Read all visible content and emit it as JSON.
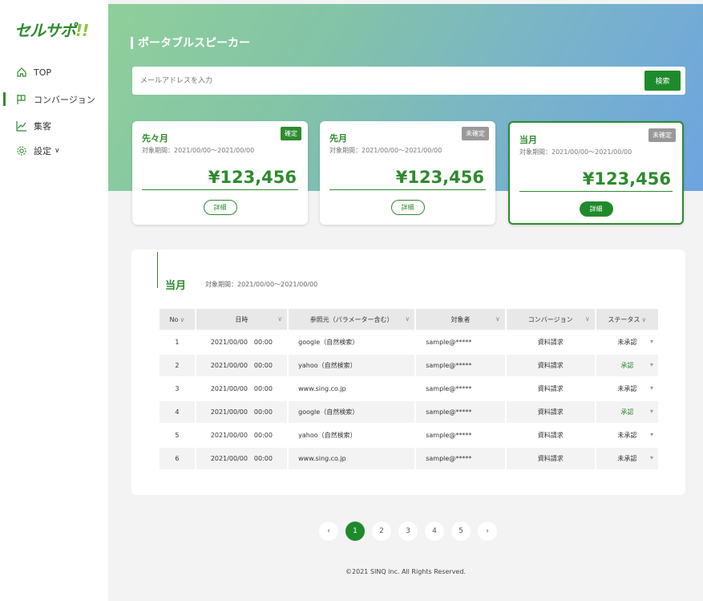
{
  "brand": {
    "name": "セルサポ",
    "mark": "!!",
    "color": "#2e8b2e"
  },
  "sidebar": {
    "items": [
      {
        "label": "TOP",
        "icon": "home-icon"
      },
      {
        "label": "コンバージョン",
        "icon": "flag-icon",
        "active": true
      },
      {
        "label": "集客",
        "icon": "chart-line-icon"
      },
      {
        "label": "設定",
        "icon": "gear-icon",
        "chevron": "∨"
      }
    ]
  },
  "page": {
    "title": "ポータブルスピーカー"
  },
  "search": {
    "placeholder": "メールアドレスを入力",
    "button": "検索"
  },
  "cards": [
    {
      "title": "先々月",
      "period": "対象期間：2021/00/00〜2021/00/00",
      "badge": "確定",
      "amount": "¥123,456",
      "detail": "詳細"
    },
    {
      "title": "先月",
      "period": "対象期間：2021/00/00〜2021/00/00",
      "badge": "未確定",
      "amount": "¥123,456",
      "detail": "詳細"
    },
    {
      "title": "当月",
      "period": "対象期間：2021/00/00〜2021/00/00",
      "badge": "未確定",
      "amount": "¥123,456",
      "detail": "詳細"
    }
  ],
  "panel": {
    "title": "当月",
    "period": "対象期間：2021/00/00〜2021/00/00"
  },
  "table": {
    "headers": [
      "No",
      "日時",
      "参照元（パラメーター含む）",
      "対象者",
      "コンバージョン",
      "ステータス"
    ],
    "rows": [
      {
        "no": "1",
        "date": "2021/00/00　00:00",
        "source": "google（自然検索）",
        "target": "sample@*****",
        "conversion": "資料請求",
        "status": "未承認"
      },
      {
        "no": "2",
        "date": "2021/00/00　00:00",
        "source": "yahoo（自然検索）",
        "target": "sample@*****",
        "conversion": "資料請求",
        "status": "承認"
      },
      {
        "no": "3",
        "date": "2021/00/00　00:00",
        "source": "www.sing.co.jp",
        "target": "sample@*****",
        "conversion": "資料請求",
        "status": "未承認"
      },
      {
        "no": "4",
        "date": "2021/00/00　00:00",
        "source": "google（自然検索）",
        "target": "sample@*****",
        "conversion": "資料請求",
        "status": "承認"
      },
      {
        "no": "5",
        "date": "2021/00/00　00:00",
        "source": "yahoo（自然検索）",
        "target": "sample@*****",
        "conversion": "資料請求",
        "status": "未承認"
      },
      {
        "no": "6",
        "date": "2021/00/00　00:00",
        "source": "www.sing.co.jp",
        "target": "sample@*****",
        "conversion": "資料請求",
        "status": "未承認"
      }
    ]
  },
  "pagination": {
    "prev": "‹",
    "pages": [
      "1",
      "2",
      "3",
      "4",
      "5"
    ],
    "current": "1",
    "next": "›"
  },
  "footer": "©2021 SINQ inc. All Rights Reserved.",
  "colors": {
    "accent": "#2e8b2e",
    "approved": "#2e8b2e",
    "pending_badge": "#999999"
  }
}
